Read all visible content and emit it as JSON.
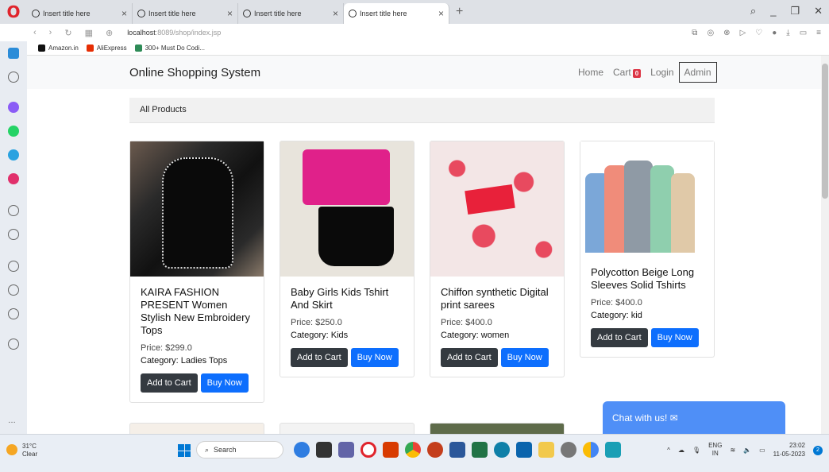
{
  "browser": {
    "tabs": [
      {
        "title": "Insert title here",
        "active": false
      },
      {
        "title": "Insert title here",
        "active": false
      },
      {
        "title": "Insert title here",
        "active": false
      },
      {
        "title": "Insert title here",
        "active": true
      }
    ],
    "url_host": "localhost",
    "url_rest": ":8089/shop/index.jsp",
    "bookmarks": [
      "Amazon.in",
      "AliExpress",
      "300+ Must Do Codi..."
    ]
  },
  "site": {
    "brand": "Online Shopping System",
    "nav": {
      "home": "Home",
      "cart": "Cart",
      "cart_count": "0",
      "login": "Login",
      "admin": "Admin"
    },
    "section_title": "All Products",
    "chat_label": "Chat with us! ✉"
  },
  "products": [
    {
      "name": "KAIRA FASHION PRESENT Women Stylish New Embroidery Tops",
      "price": "Price: $299.0",
      "category": "Category: Ladies Tops",
      "add": "Add to Cart",
      "buy": "Buy Now"
    },
    {
      "name": "Baby Girls Kids Tshirt And Skirt",
      "price": "Price: $250.0",
      "category": "Category: Kids",
      "add": "Add to Cart",
      "buy": "Buy Now"
    },
    {
      "name": "Chiffon synthetic Digital print sarees",
      "price": "Price: $400.0",
      "category": "Category: women",
      "add": "Add to Cart",
      "buy": "Buy Now"
    },
    {
      "name": "Polycotton Beige Long Sleeves Solid Tshirts",
      "price": "Price: $400.0",
      "category": "Category: kid",
      "add": "Add to Cart",
      "buy": "Buy Now"
    }
  ],
  "taskbar": {
    "weather_temp": "31°C",
    "weather_desc": "Clear",
    "search": "Search",
    "lang1": "ENG",
    "lang2": "IN",
    "time": "23:02",
    "date": "11-05-2023",
    "notif": "2"
  }
}
